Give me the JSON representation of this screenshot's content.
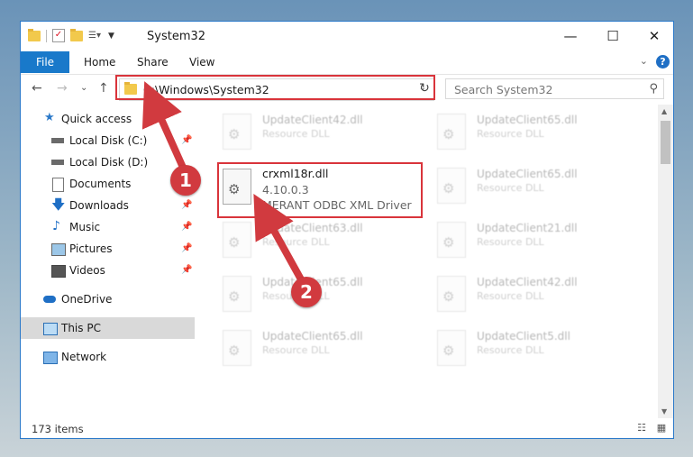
{
  "window": {
    "title": "System32",
    "controls": {
      "minimize": "—",
      "maximize": "☐",
      "close": "✕"
    }
  },
  "ribbon": {
    "tabs": [
      "File",
      "Home",
      "Share",
      "View"
    ],
    "help": "?",
    "collapse": "⌄"
  },
  "nav": {
    "back": "←",
    "forward": "→",
    "recent": "⌄",
    "up": "↑",
    "address": "C:\\Windows\\System32",
    "refresh": "↻",
    "search_placeholder": "Search System32"
  },
  "sidebar": {
    "items": [
      {
        "label": "Quick access",
        "icon": "star-icon",
        "pinned": false
      },
      {
        "label": "Local Disk (C:)",
        "icon": "drive-icon",
        "pinned": true
      },
      {
        "label": "Local Disk (D:)",
        "icon": "drive-icon",
        "pinned": false
      },
      {
        "label": "Documents",
        "icon": "document-icon",
        "pinned": true
      },
      {
        "label": "Downloads",
        "icon": "download-icon",
        "pinned": true
      },
      {
        "label": "Music",
        "icon": "music-icon",
        "pinned": true
      },
      {
        "label": "Pictures",
        "icon": "pictures-icon",
        "pinned": true
      },
      {
        "label": "Videos",
        "icon": "videos-icon",
        "pinned": true
      },
      {
        "label": "OneDrive",
        "icon": "cloud-icon",
        "pinned": false
      },
      {
        "label": "This PC",
        "icon": "computer-icon",
        "pinned": false,
        "selected": true
      },
      {
        "label": "Network",
        "icon": "network-icon",
        "pinned": false
      }
    ]
  },
  "files": {
    "background": [
      {
        "name": "UpdateClient42.dll",
        "desc": "Resource DLL"
      },
      {
        "name": "UpdateClient65.dll",
        "desc": "Resource DLL"
      },
      {
        "name": "UpdateClient65.dll",
        "desc": "Resource DLL"
      },
      {
        "name": "UpdateClient63.dll",
        "desc": "Resource DLL"
      },
      {
        "name": "UpdateClient21.dll",
        "desc": "Resource DLL"
      },
      {
        "name": "UpdateClient65.dll",
        "desc": "Resource DLL"
      },
      {
        "name": "UpdateClient42.dll",
        "desc": "Resource DLL"
      },
      {
        "name": "UpdateClient65.dll",
        "desc": "Resource DLL"
      },
      {
        "name": "UpdateClient5.dll",
        "desc": "Resource DLL"
      }
    ],
    "highlighted": {
      "name": "crxml18r.dll",
      "version": "4.10.0.3",
      "description": "MERANT ODBC XML Driver"
    }
  },
  "annotations": {
    "step1": "1",
    "step2": "2",
    "color": "#d13a3f"
  },
  "status": {
    "item_count": "173 items"
  }
}
